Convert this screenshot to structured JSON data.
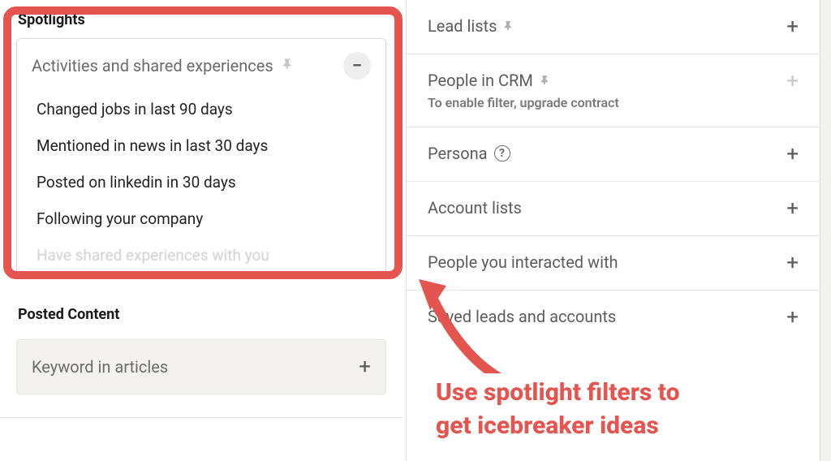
{
  "left": {
    "spotlights_heading": "Spotlights",
    "activities_card": {
      "title": "Activities and shared experiences",
      "options": [
        "Changed jobs in last 90 days",
        "Mentioned in news in last 30 days",
        "Posted on linkedin in 30 days",
        "Following your company",
        "Have shared experiences with you"
      ]
    },
    "posted_content_heading": "Posted Content",
    "keyword_in_articles": "Keyword in articles"
  },
  "right": {
    "filters": [
      {
        "label": "Lead lists",
        "pinned": true,
        "disabled": false,
        "sub": ""
      },
      {
        "label": "People in CRM",
        "pinned": true,
        "disabled": true,
        "sub": "To enable filter, upgrade contract"
      },
      {
        "label": "Persona",
        "help": true,
        "disabled": false,
        "sub": ""
      },
      {
        "label": "Account lists",
        "disabled": false,
        "sub": ""
      },
      {
        "label": "People you interacted with",
        "disabled": false,
        "sub": ""
      },
      {
        "label": "Saved leads and accounts",
        "disabled": false,
        "sub": ""
      }
    ]
  },
  "callout": {
    "line1": "Use spotlight filters to",
    "line2": "get icebreaker ideas"
  }
}
